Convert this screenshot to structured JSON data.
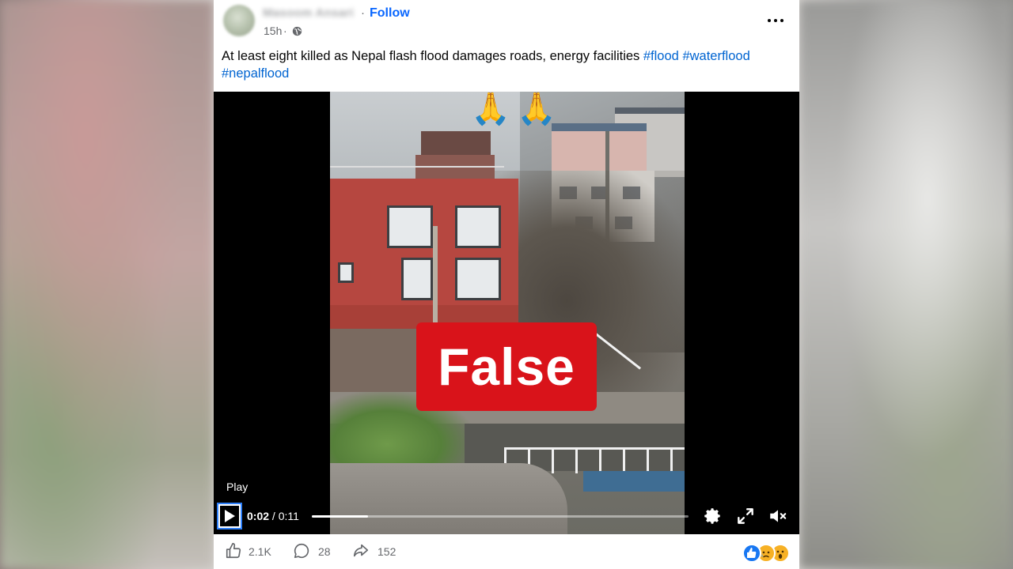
{
  "post": {
    "author": "Masoom Ansari",
    "separator": "·",
    "follow_label": "Follow",
    "time": "15h",
    "time_separator": "·",
    "privacy_icon": "globe-icon",
    "text_main": "At least eight killed as Nepal flash flood damages roads, energy facilities ",
    "hashtags": [
      "#flood",
      "#waterflood",
      "#nepalflood"
    ]
  },
  "video": {
    "overlay_emoji": "🙏",
    "badge_label": "False",
    "badge_color": "#d9131a",
    "play_label": "Play",
    "current_time": "0:02",
    "time_separator": " / ",
    "duration": "0:11",
    "progress_fraction": 0.15,
    "controls": [
      "settings-gear-icon",
      "fullscreen-icon",
      "mute-icon"
    ]
  },
  "footer": {
    "likes": "2.1K",
    "comments": "28",
    "shares": "152",
    "reaction_icons": [
      "like-reaction-icon",
      "sad-reaction-icon",
      "wow-reaction-icon"
    ]
  },
  "colors": {
    "link_blue": "#0064d1",
    "follow_blue": "#0866ff",
    "meta_gray": "#65676b"
  }
}
